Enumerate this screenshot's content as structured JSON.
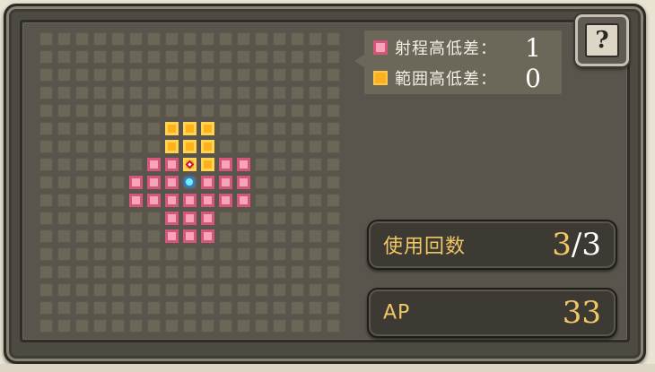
{
  "legend": {
    "range_height": {
      "label": "射程高低差：",
      "value": "1",
      "color": "#f8a3b8"
    },
    "area_height": {
      "label": "範囲高低差：",
      "value": "0",
      "color": "#ffb01e"
    }
  },
  "help_button": {
    "icon": "question-book-icon",
    "glyph": "?"
  },
  "uses": {
    "label": "使用回数",
    "current": "3",
    "separator": "/",
    "max": "3"
  },
  "ap": {
    "label": "AP",
    "value": "33"
  },
  "grid": {
    "columns": 17,
    "rows": 17,
    "pink_cells": [
      [
        6,
        7
      ],
      [
        7,
        7
      ],
      [
        10,
        7
      ],
      [
        11,
        7
      ],
      [
        5,
        8
      ],
      [
        6,
        8
      ],
      [
        7,
        8
      ],
      [
        9,
        8
      ],
      [
        10,
        8
      ],
      [
        11,
        8
      ],
      [
        5,
        9
      ],
      [
        6,
        9
      ],
      [
        7,
        9
      ],
      [
        8,
        9
      ],
      [
        9,
        9
      ],
      [
        10,
        9
      ],
      [
        11,
        9
      ],
      [
        7,
        10
      ],
      [
        8,
        10
      ],
      [
        9,
        10
      ],
      [
        7,
        11
      ],
      [
        8,
        11
      ],
      [
        9,
        11
      ]
    ],
    "orange_cells": [
      [
        7,
        5
      ],
      [
        8,
        5
      ],
      [
        9,
        5
      ],
      [
        7,
        6
      ],
      [
        8,
        6
      ],
      [
        9,
        6
      ],
      [
        8,
        7
      ],
      [
        9,
        7
      ]
    ],
    "target_marker": [
      8,
      7
    ],
    "player_marker": [
      8,
      8
    ]
  },
  "colors": {
    "gold": "#f1c765",
    "pink": "#f8a3b8",
    "orange": "#ffb01e"
  }
}
